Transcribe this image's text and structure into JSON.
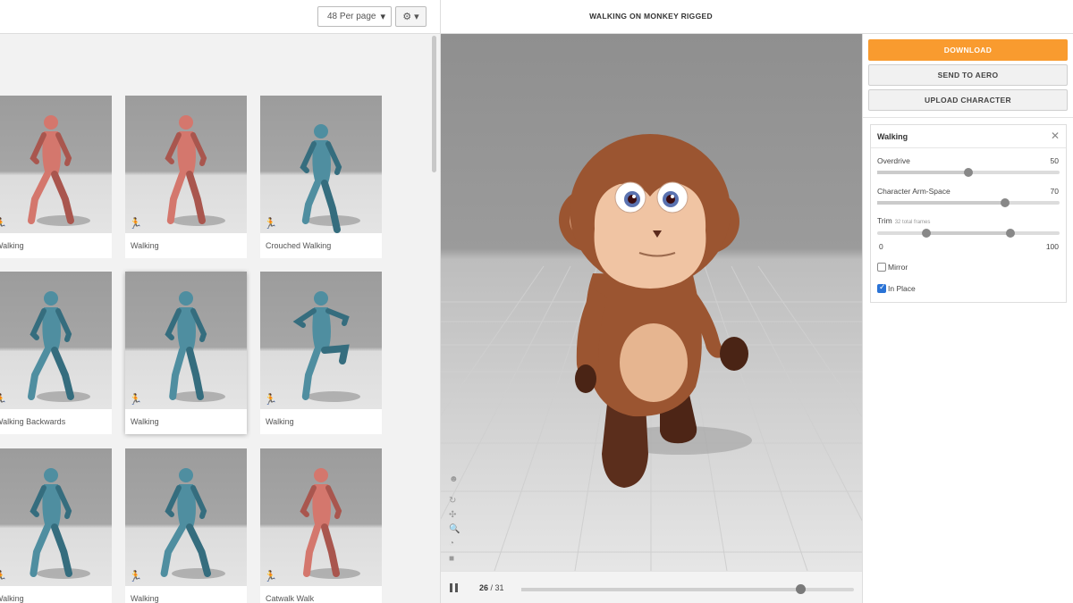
{
  "toolbar": {
    "per_page": "48 Per page",
    "caret": "▾",
    "gear": "⚙ ▾"
  },
  "cards": [
    {
      "label": "Walking",
      "color": "#d4776d"
    },
    {
      "label": "Walking",
      "color": "#d4776d"
    },
    {
      "label": "Crouched Walking",
      "color": "#4f8ea0"
    },
    {
      "label": "Walking Backwards",
      "color": "#4f8ea0"
    },
    {
      "label": "Walking",
      "color": "#4f8ea0"
    },
    {
      "label": "Walking",
      "color": "#4f8ea0"
    },
    {
      "label": "Walking",
      "color": "#4f8ea0"
    },
    {
      "label": "Walking",
      "color": "#4f8ea0"
    },
    {
      "label": "Catwalk Walk",
      "color": "#d4776d"
    }
  ],
  "run_icon": "🏃",
  "viewer": {
    "title": "WALKING ON MONKEY RIGGED"
  },
  "viewport_tools": [
    "☻",
    "↻",
    "✣",
    "🔍",
    "◔",
    "■"
  ],
  "playback": {
    "current_frame": "26",
    "separator": " / ",
    "total_frames": "31",
    "progress": 0.84
  },
  "actions": {
    "download": "DOWNLOAD",
    "send_to_aero": "SEND TO AERO",
    "upload_character": "UPLOAD CHARACTER"
  },
  "animation_panel": {
    "title": "Walking",
    "close": "✕",
    "overdrive": {
      "label": "Overdrive",
      "value": "50",
      "fraction": 0.5
    },
    "arm_space": {
      "label": "Character Arm-Space",
      "value": "70",
      "fraction": 0.7
    },
    "trim": {
      "label": "Trim",
      "subtitle": "32 total frames",
      "min_label": "0",
      "max_label": "100",
      "start": 0.27,
      "end": 0.73
    },
    "mirror": {
      "label": "Mirror",
      "checked": false
    },
    "in_place": {
      "label": "In Place",
      "checked": true
    }
  },
  "colors": {
    "accent": "#f99b2f",
    "checkbox": "#2a73d6"
  }
}
